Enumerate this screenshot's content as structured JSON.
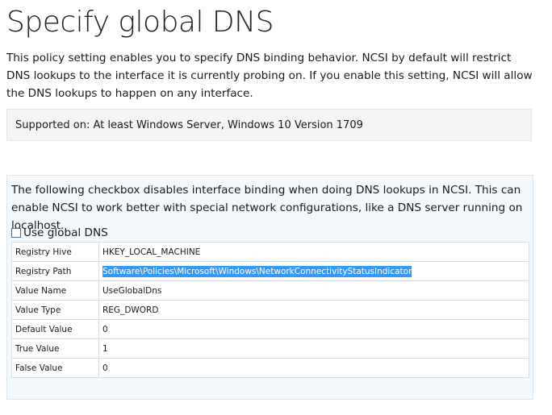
{
  "title": "Specify global DNS",
  "description": "This policy setting enables you to specify DNS binding behavior. NCSI by default will restrict DNS lookups to the interface it is currently probing on. If you enable this setting, NCSI will allow the DNS lookups to happen on any interface.",
  "supported_on": "Supported on: At least Windows Server, Windows 10 Version 1709",
  "options": {
    "description": "The following checkbox disables interface binding when doing DNS lookups in NCSI. This can enable NCSI to work better with special network configurations, like a DNS server running on localhost.",
    "checkbox_label": "Use global DNS",
    "checkbox_checked": false
  },
  "registry": [
    {
      "key": "Registry Hive",
      "value": "HKEY_LOCAL_MACHINE"
    },
    {
      "key": "Registry Path",
      "value": "Software\\Policies\\Microsoft\\Windows\\NetworkConnectivityStatusIndicator"
    },
    {
      "key": "Value Name",
      "value": "UseGlobalDns"
    },
    {
      "key": "Value Type",
      "value": "REG_DWORD"
    },
    {
      "key": "Default Value",
      "value": "0"
    },
    {
      "key": "True Value",
      "value": "1"
    },
    {
      "key": "False Value",
      "value": "0"
    }
  ],
  "colors": {
    "selection": "#3399ff",
    "options_background": "#f2f8fb",
    "supported_background": "#f4f4f4"
  }
}
